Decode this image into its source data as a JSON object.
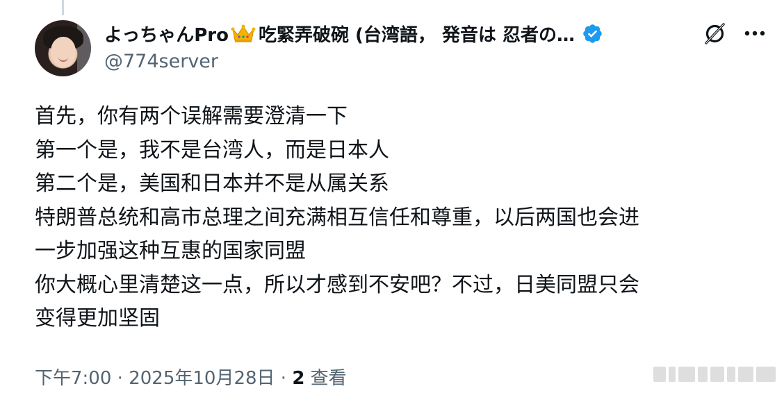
{
  "author": {
    "display_name": "よっちゃんPro",
    "crown_emoji": "crown-icon",
    "name_suffix": "吃緊弄破碗 (台湾語， 発音は 忍者の…",
    "handle": "@774server",
    "verified_color": "#1d9bf0"
  },
  "icons": {
    "grok": "grok-icon",
    "more": "more-icon"
  },
  "post": {
    "lines": [
      "首先，你有两个误解需要澄清一下",
      "第一个是，我不是台湾人，而是日本人",
      "第二个是，美国和日本并不是从属关系",
      "特朗普总统和高市总理之间充满相互信任和尊重，以后两国也会进",
      "一步加强这种互惠的国家同盟",
      "你大概心里清楚这一点，所以才感到不安吧？不过，日美同盟只会",
      "变得更加坚固"
    ]
  },
  "meta": {
    "time": "下午7:00",
    "separator": " · ",
    "date": "2025年10月28日",
    "views_count": "2",
    "views_label": " 查看"
  }
}
